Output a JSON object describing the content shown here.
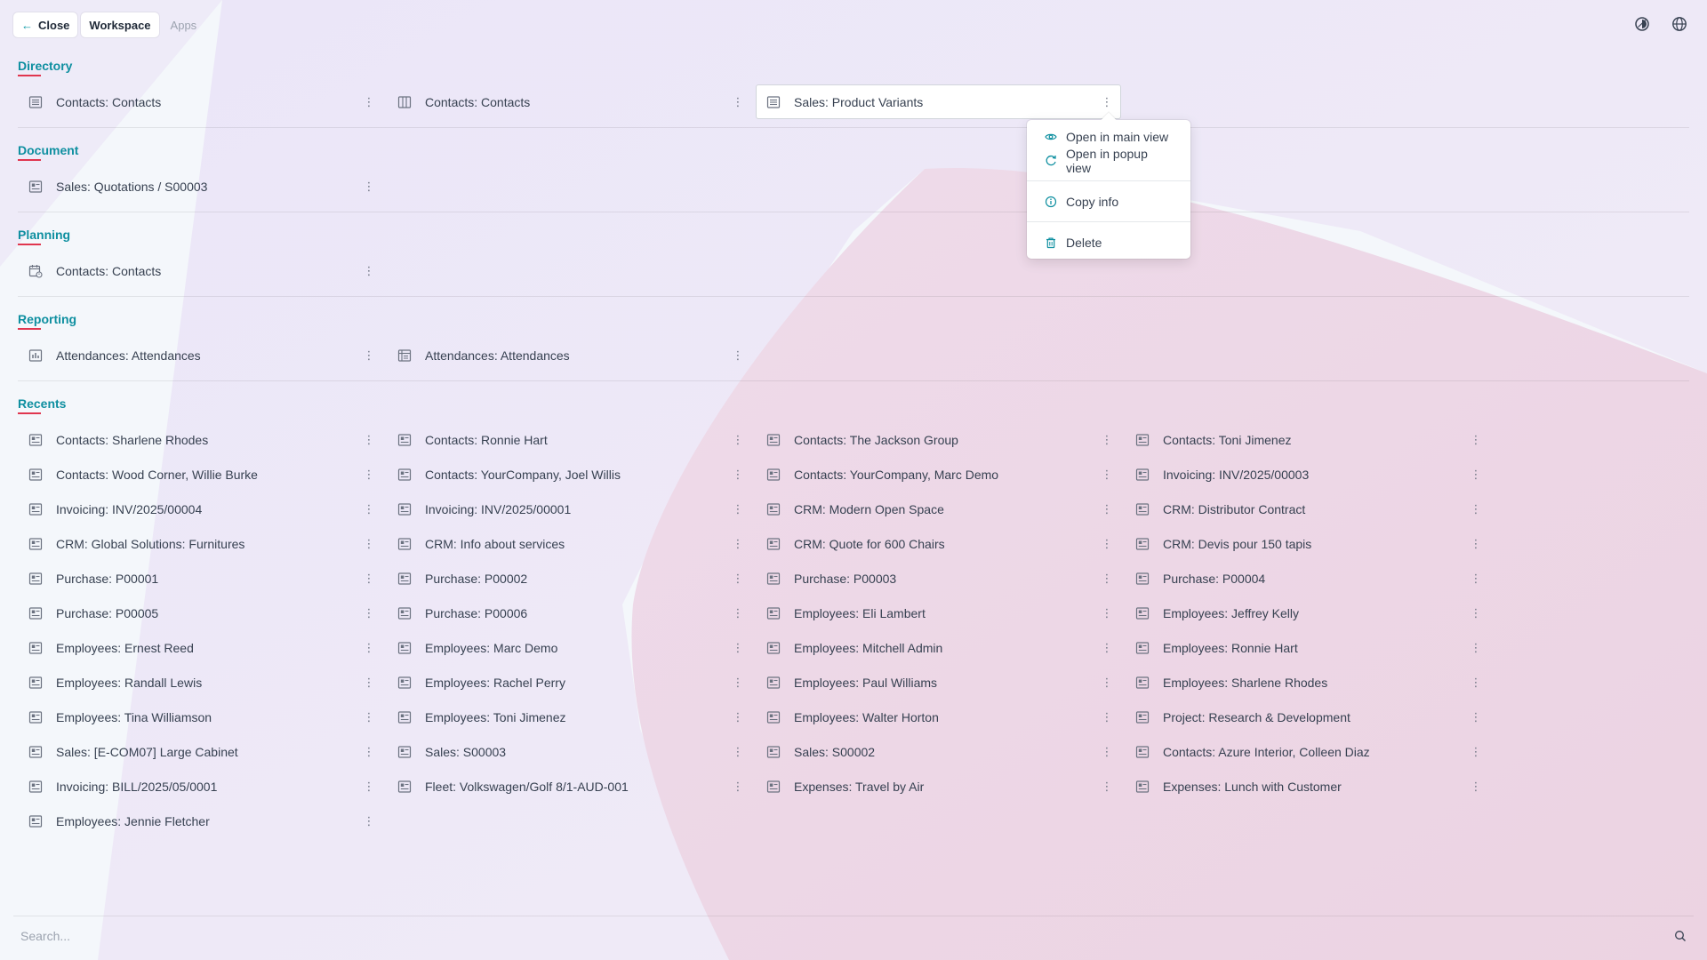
{
  "topbar": {
    "close_label": "Close",
    "workspace_label": "Workspace",
    "apps_label": "Apps"
  },
  "top_icons": [
    "theme-icon",
    "globe-icon"
  ],
  "sections": {
    "directory": {
      "title": "Directory",
      "items": [
        {
          "label": "Contacts: Contacts",
          "icon": "list-icon"
        },
        {
          "label": "Contacts: Contacts",
          "icon": "kanban-icon"
        },
        {
          "label": "Sales: Product Variants",
          "icon": "list-icon"
        }
      ]
    },
    "document": {
      "title": "Document",
      "items": [
        {
          "label": "Sales: Quotations / S00003",
          "icon": "form-icon"
        }
      ]
    },
    "planning": {
      "title": "Planning",
      "items": [
        {
          "label": "Contacts: Contacts",
          "icon": "calendar-icon"
        }
      ]
    },
    "reporting": {
      "title": "Reporting",
      "items": [
        {
          "label": "Attendances: Attendances",
          "icon": "chart-icon"
        },
        {
          "label": "Attendances: Attendances",
          "icon": "pivot-icon"
        }
      ]
    },
    "recents": {
      "title": "Recents",
      "items": [
        {
          "label": "Contacts: Sharlene Rhodes"
        },
        {
          "label": "Contacts: Ronnie Hart"
        },
        {
          "label": "Contacts: The Jackson Group"
        },
        {
          "label": "Contacts: Toni Jimenez"
        },
        {
          "label": "Contacts: Wood Corner, Willie Burke"
        },
        {
          "label": "Contacts: YourCompany, Joel Willis"
        },
        {
          "label": "Contacts: YourCompany, Marc Demo"
        },
        {
          "label": "Invoicing: INV/2025/00003"
        },
        {
          "label": "Invoicing: INV/2025/00004"
        },
        {
          "label": "Invoicing: INV/2025/00001"
        },
        {
          "label": "CRM: Modern Open Space"
        },
        {
          "label": "CRM: Distributor Contract"
        },
        {
          "label": "CRM: Global Solutions: Furnitures"
        },
        {
          "label": "CRM: Info about services"
        },
        {
          "label": "CRM: Quote for 600 Chairs"
        },
        {
          "label": "CRM: Devis pour 150 tapis"
        },
        {
          "label": "Purchase: P00001"
        },
        {
          "label": "Purchase: P00002"
        },
        {
          "label": "Purchase: P00003"
        },
        {
          "label": "Purchase: P00004"
        },
        {
          "label": "Purchase: P00005"
        },
        {
          "label": "Purchase: P00006"
        },
        {
          "label": "Employees: Eli Lambert"
        },
        {
          "label": "Employees: Jeffrey Kelly"
        },
        {
          "label": "Employees: Ernest Reed"
        },
        {
          "label": "Employees: Marc Demo"
        },
        {
          "label": "Employees: Mitchell Admin"
        },
        {
          "label": "Employees: Ronnie Hart"
        },
        {
          "label": "Employees: Randall Lewis"
        },
        {
          "label": "Employees: Rachel Perry"
        },
        {
          "label": "Employees: Paul Williams"
        },
        {
          "label": "Employees: Sharlene Rhodes"
        },
        {
          "label": "Employees: Tina Williamson"
        },
        {
          "label": "Employees: Toni Jimenez"
        },
        {
          "label": "Employees: Walter Horton"
        },
        {
          "label": "Project: Research & Development"
        },
        {
          "label": "Sales: [E-COM07] Large Cabinet"
        },
        {
          "label": "Sales: S00003"
        },
        {
          "label": "Sales: S00002"
        },
        {
          "label": "Contacts: Azure Interior, Colleen Diaz"
        },
        {
          "label": "Invoicing: BILL/2025/05/0001"
        },
        {
          "label": "Fleet: Volkswagen/Golf 8/1-AUD-001"
        },
        {
          "label": "Expenses: Travel by Air"
        },
        {
          "label": "Expenses: Lunch with Customer"
        },
        {
          "label": "Employees: Jennie Fletcher"
        }
      ]
    }
  },
  "context_menu": {
    "open_main": "Open in main view",
    "open_popup": "Open in popup view",
    "copy_info": "Copy info",
    "delete": "Delete"
  },
  "search": {
    "placeholder": "Search...",
    "value": ""
  },
  "colors": {
    "accent": "#0e8fa0",
    "underline": "#e0364f",
    "bg_lilac": "#ece4f6",
    "bg_pink": "#efd4e3"
  }
}
